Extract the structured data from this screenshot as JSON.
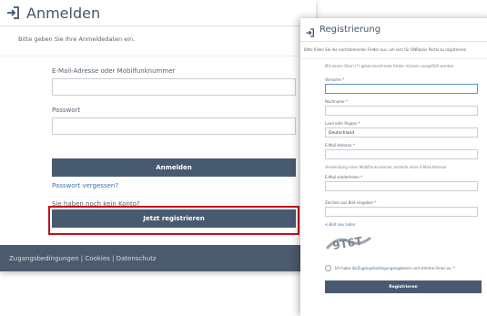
{
  "login": {
    "title": "Anmelden",
    "intro": "Bitte geben Sie Ihre Anmeldedaten ein.",
    "email_label": "E-Mail-Adresse oder Mobilfunknummer",
    "password_label": "Passwort",
    "submit_label": "Anmelden",
    "forgot_link": "Passwort vergessen?",
    "no_account": "Sie haben noch kein Konto?",
    "register_label": "Jetzt registrieren",
    "footer": "Zugangsbedingungen | Cookies | Datenschutz"
  },
  "registration": {
    "title": "Registrierung",
    "intro": "Bitte füllen Sie die nachstehenden Felder aus, um sich für ONRlplus Portal zu registrieren",
    "required_note": "Mit einem Stern (*) gekennzeichnete Felder müssen ausgefüllt werden.",
    "first_name_label": "Vorname *",
    "last_name_label": "Nachname *",
    "country_label": "Land oder Region *",
    "country_value": "Deutschland",
    "email_label": "E-Mail-Adresse *",
    "mobile_hint": "Verwendung einer Mobilfunknummer anstelle einer E-Mail-Adresse",
    "email_repeat_label": "E-Mail wiederholen *",
    "captcha_label": "Zeichen aus Bild eingeben *",
    "reload_image_link": "Bild neu laden",
    "captcha_text": "9T6T",
    "terms_prefix": "Ich habe die ",
    "terms_link": "Zugangsbedingungen",
    "terms_suffix": " gelesen und stimme ihnen zu. *",
    "submit_label": "Registrieren"
  },
  "colors": {
    "button_dark": "#475a70",
    "highlight": "#c1121c",
    "link": "#3b73b9"
  },
  "icons": {
    "header_icon": "login-arrow-icon"
  }
}
